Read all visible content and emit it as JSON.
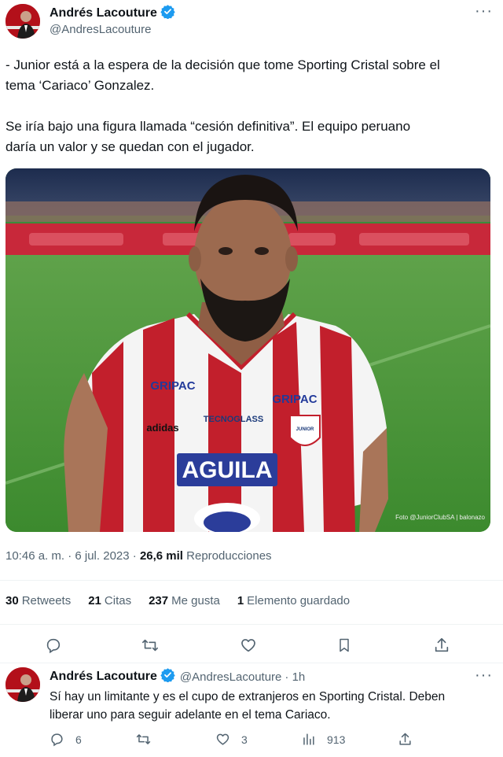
{
  "tweet": {
    "author_name": "Andrés Lacouture",
    "author_handle": "@AndresLacouture",
    "text_line1": "- Junior está a la espera de la decisión que tome Sporting Cristal sobre el",
    "text_line2": "tema ‘Cariaco’ Gonzalez.",
    "text_line3": "Se iría bajo una figura llamada “cesión definitiva”. El equipo peruano",
    "text_line4": "daría un valor y se quedan con el jugador.",
    "time": "10:46 a. m. · 6 jul. 2023 ·",
    "views_count": "26,6 mil",
    "views_label": "Reproducciones",
    "stats": {
      "retweets_count": "30",
      "retweets_label": "Retweets",
      "quotes_count": "21",
      "quotes_label": "Citas",
      "likes_count": "237",
      "likes_label": "Me gusta",
      "bookmarks_count": "1",
      "bookmarks_label": "Elemento guardado"
    },
    "photo": {
      "shirt_sponsor": "AGUILA",
      "shirt_logo_left": "GRIPAC",
      "shirt_logo_right": "GRIPAC",
      "shirt_brand": "adidas",
      "shirt_tech": "TECNOGLASS",
      "shirt_crest": "JUNIOR",
      "credit": "Foto @JuniorClubSA  |  balonazo"
    }
  },
  "reply": {
    "author_name": "Andrés Lacouture",
    "author_handle": "@AndresLacouture",
    "age": "· 1h",
    "text_line1": "Sí hay un limitante y es el cupo de extranjeros en Sporting Cristal. Deben",
    "text_line2": "liberar uno para seguir adelante en el tema Cariaco.",
    "replies_count": "6",
    "likes_count": "3",
    "views_count": "913"
  },
  "icons": [
    "more-icon",
    "verified-icon",
    "reply-icon",
    "retweet-icon",
    "like-icon",
    "bookmark-icon",
    "share-icon",
    "views-icon"
  ],
  "colors": {
    "verified": "#1d9bf0",
    "secondary_text": "#536471",
    "divider": "#eff3f4"
  }
}
